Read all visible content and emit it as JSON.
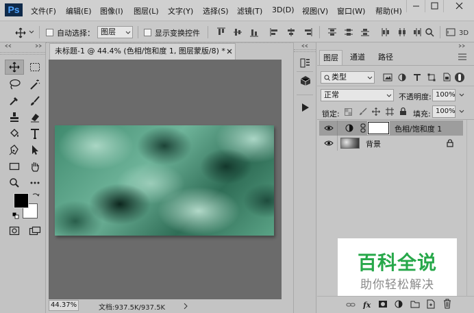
{
  "app": {
    "logo": "Ps"
  },
  "menu": [
    "文件(F)",
    "编辑(E)",
    "图像(I)",
    "图层(L)",
    "文字(Y)",
    "选择(S)",
    "滤镜(T)",
    "3D(D)",
    "视图(V)",
    "窗口(W)",
    "帮助(H)"
  ],
  "options": {
    "auto_select_label": "自动选择：",
    "auto_select_value": "图层",
    "show_transform_label": "显示变换控件"
  },
  "document": {
    "tab_title": "未标题-1 @ 44.4% (色相/饱和度 1, 图层蒙版/8) *",
    "zoom": "44.37%",
    "info": "文档:937.5K/937.5K"
  },
  "panel": {
    "tabs": [
      "图层",
      "通道",
      "路径"
    ],
    "filter_type": "类型",
    "blend_mode": "正常",
    "opacity_label": "不透明度:",
    "opacity_value": "100%",
    "lock_label": "锁定:",
    "fill_label": "填充:",
    "fill_value": "100%",
    "layers": [
      {
        "name": "色相/饱和度 1"
      },
      {
        "name": "背景"
      }
    ]
  },
  "watermark": {
    "title": "百科全说",
    "subtitle": "助你轻松解决"
  },
  "colors": {
    "accent_blue": "#4ea3ff",
    "watermark_green": "#27a84a"
  }
}
